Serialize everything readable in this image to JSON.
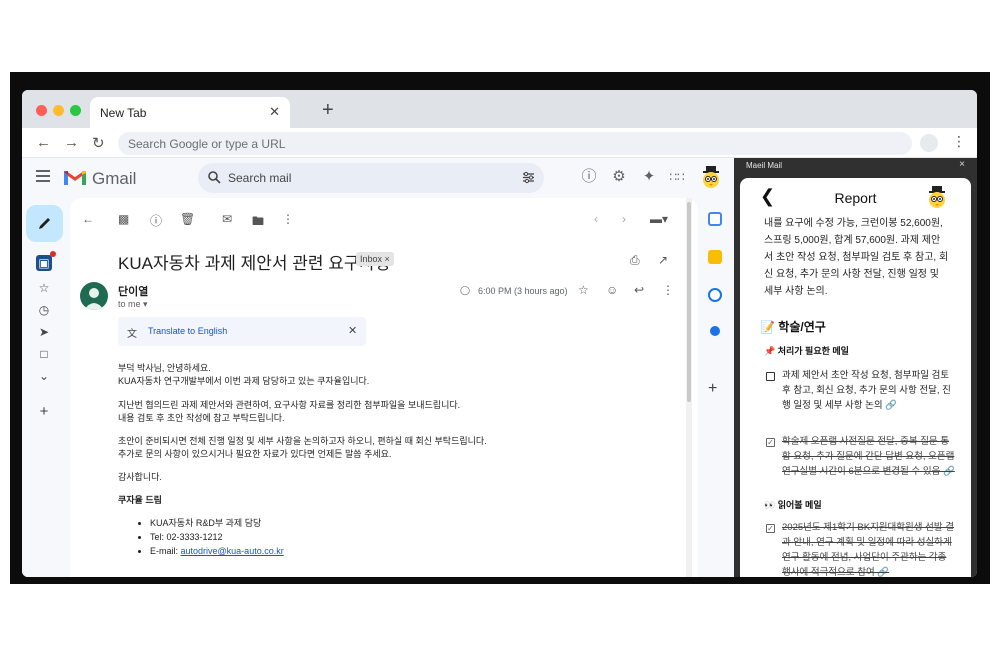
{
  "browser": {
    "tab_title": "New Tab",
    "tab_close": "✕",
    "new_tab": "+",
    "url_placeholder": "Search Google or type a URL",
    "menu": "⋮"
  },
  "gmail": {
    "brand": "Gmail",
    "search_placeholder": "Search mail"
  },
  "email": {
    "subject": "KUA자동차 과제 제안서 관련 요구사항",
    "label_chip": "Inbox ×",
    "sender": "단이열",
    "to": "to me ▾",
    "time": "6:00 PM (3 hours ago)",
    "translate": "Translate to English",
    "body": [
      "부덕 박사님, 안녕하세요.",
      "KUA자동차 연구개발부에서 이번 과제 담당하고 있는 쿠자율입니다.",
      "지난번 협의드린 과제 제안서와 관련하여, 요구사항 자료를 정리한 첨부파일을 보내드립니다.",
      "내용 검토 후 초안 작성에 참고 부탁드립니다.",
      "초안이 준비되시면 전체 진행 일정 및 세부 사항을 논의하고자 하오니, 편하실 때 회신 부탁드립니다.",
      "추가로 문의 사항이 있으시거나 필요한 자료가 있다면 언제든 말씀 주세요.",
      "감사합니다."
    ],
    "signature": "쿠자율 드림",
    "sig_lines": [
      "KUA자동차 R&D부 과제 담당",
      "Tel: 02-3333-1212",
      "E-mail: "
    ],
    "email_link": "autodrive@kua-auto.co.kr"
  },
  "panel": {
    "title": "Maeil Mail",
    "close": "×",
    "report_title": "Report",
    "back": "❮",
    "intro_lines": [
      "내를 요구에 수정 가능, 크런이봉 52,600원,",
      "스프링 5,000원, 합계 57,600원. 과제 제안",
      "서 초안 작성 요청, 첨부파일 검토 후 참고, 회",
      "신 요청, 추가 문의 사항 전달, 진행 일정 및",
      "세부 사항 논의."
    ],
    "section_title": "📝 학술/연구",
    "todo_heading": "📌 처리가 필요한 메일",
    "todo_item": "과제 제안서 초안 작성 요청, 첨부파일 검토 후 참고, 회신 요청, 추가 문의 사항 전달, 진행 일정 및 세부 사항 논의 🔗",
    "done_item_1": "학술제 오픈랩 사전질문 전달, 중복 질문 통합 요청, 추가 질문에 간단 답변 요청, 오픈랩 연구실별 시간이 6분으로 변경될 수 있음 🔗",
    "read_heading": "👀 읽어볼 메일",
    "done_item_2": "2025년도 제1학기 BK지원대학원생 선발 결과 안내, 연구 계획 및 일정에 따라 성실하게 연구 활동에 전념, 사업단이 주관하는 각종 행사에 적극적으로 참여 🔗"
  }
}
